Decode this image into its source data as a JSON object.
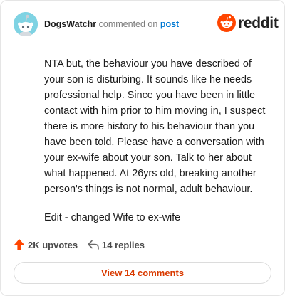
{
  "comment": {
    "author": "DogsWatchr",
    "action_text": "commented on",
    "post_link": "post",
    "paragraphs": [
      "NTA but, the behaviour you have described of your son is disturbing. It sounds like he needs professional help. Since you have been in little contact with him prior to him moving in, I suspect there is more history to his behaviour than you have been told. Please have a conversation with your ex-wife about your son. Talk to her about what happened. At 26yrs old, breaking another person's things is not normal, adult behaviour.",
      "Edit - changed Wife to ex-wife"
    ]
  },
  "brand": {
    "wordmark": "reddit",
    "icon": "reddit-alien-icon",
    "color": "#ff4500"
  },
  "avatar": {
    "icon": "snoo-avatar",
    "background": "#7fd3e3"
  },
  "actions": {
    "upvotes": "2K upvotes",
    "upvote_icon": "upvote-arrow-icon",
    "upvote_color": "#ff4500",
    "replies": "14 replies",
    "reply_icon": "reply-arrow-icon"
  },
  "view_comments_label": "View 14 comments",
  "accent_color": "#d93a00"
}
